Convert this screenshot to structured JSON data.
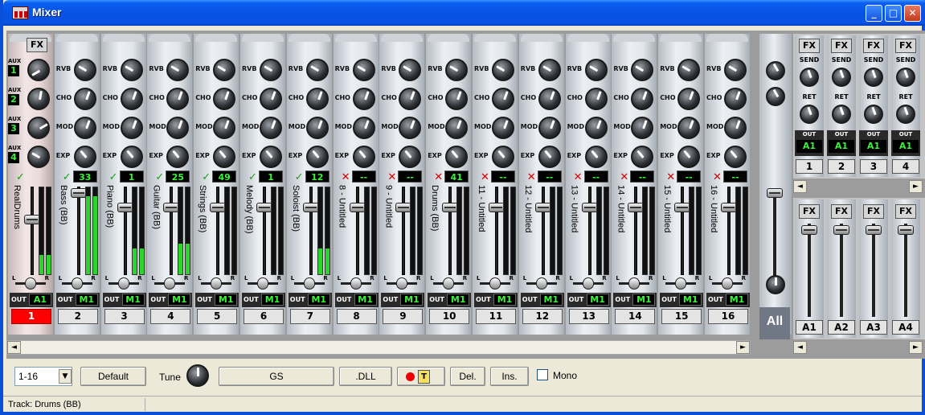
{
  "window": {
    "title": "Mixer",
    "minimize": "_",
    "maximize": "□",
    "close": "✕"
  },
  "aux": [
    "1",
    "2",
    "3",
    "4"
  ],
  "aux_label": "AUX",
  "row_labels": [
    "RVB",
    "CHO",
    "MOD",
    "EXP"
  ],
  "fx_label": "FX",
  "pan_left": "L",
  "pan_right": "R",
  "out_label": "OUT",
  "strips": [
    {
      "number": "1",
      "name": "RealDrums",
      "status": "ok",
      "status_glyph": "✓",
      "program": "",
      "out": "A1",
      "level": 0.22,
      "knobs": [
        240,
        10,
        60,
        300
      ],
      "selected": true
    },
    {
      "number": "2",
      "name": "Bass   (BB)",
      "status": "ok",
      "status_glyph": "✓",
      "program": "33",
      "out": "M1",
      "level": 0.9,
      "knobs": [
        300,
        20,
        20,
        320
      ],
      "selected": false
    },
    {
      "number": "3",
      "name": "Piano   (BB)",
      "status": "ok",
      "status_glyph": "✓",
      "program": "1",
      "out": "M1",
      "level": 0.3,
      "knobs": [
        300,
        20,
        20,
        320
      ],
      "selected": false
    },
    {
      "number": "4",
      "name": "Guitar   (BB)",
      "status": "ok",
      "status_glyph": "✓",
      "program": "25",
      "out": "M1",
      "level": 0.35,
      "knobs": [
        300,
        20,
        20,
        320
      ],
      "selected": false
    },
    {
      "number": "5",
      "name": "Strings (BB)",
      "status": "ok",
      "status_glyph": "✓",
      "program": "49",
      "out": "M1",
      "level": 0.0,
      "knobs": [
        300,
        20,
        20,
        320
      ],
      "selected": false
    },
    {
      "number": "6",
      "name": "Melody  (BB)",
      "status": "ok",
      "status_glyph": "✓",
      "program": "1",
      "out": "M1",
      "level": 0.0,
      "knobs": [
        300,
        20,
        20,
        320
      ],
      "selected": false
    },
    {
      "number": "7",
      "name": "Soloist (BB)",
      "status": "ok",
      "status_glyph": "✓",
      "program": "12",
      "out": "M1",
      "level": 0.3,
      "knobs": [
        300,
        20,
        20,
        320
      ],
      "selected": false
    },
    {
      "number": "8",
      "name": "8 - Untitled",
      "status": "x",
      "status_glyph": "✕",
      "program": "--",
      "out": "M1",
      "level": 0.0,
      "knobs": [
        300,
        20,
        20,
        320
      ],
      "selected": false
    },
    {
      "number": "9",
      "name": "9 - Untitled",
      "status": "x",
      "status_glyph": "✕",
      "program": "--",
      "out": "M1",
      "level": 0.0,
      "knobs": [
        300,
        20,
        20,
        320
      ],
      "selected": false
    },
    {
      "number": "10",
      "name": "Drums   (BB)",
      "status": "x",
      "status_glyph": "✕",
      "program": "41",
      "out": "M1",
      "level": 0.0,
      "knobs": [
        300,
        20,
        20,
        320
      ],
      "selected": false
    },
    {
      "number": "11",
      "name": "11 - Untitled",
      "status": "x",
      "status_glyph": "✕",
      "program": "--",
      "out": "M1",
      "level": 0.0,
      "knobs": [
        300,
        20,
        20,
        320
      ],
      "selected": false
    },
    {
      "number": "12",
      "name": "12 - Untitled",
      "status": "x",
      "status_glyph": "✕",
      "program": "--",
      "out": "M1",
      "level": 0.0,
      "knobs": [
        300,
        20,
        20,
        320
      ],
      "selected": false
    },
    {
      "number": "13",
      "name": "13 - Untitled",
      "status": "x",
      "status_glyph": "✕",
      "program": "--",
      "out": "M1",
      "level": 0.0,
      "knobs": [
        300,
        20,
        20,
        320
      ],
      "selected": false
    },
    {
      "number": "14",
      "name": "14 - Untitled",
      "status": "x",
      "status_glyph": "✕",
      "program": "--",
      "out": "M1",
      "level": 0.0,
      "knobs": [
        300,
        20,
        20,
        320
      ],
      "selected": false
    },
    {
      "number": "15",
      "name": "15 - Untitled",
      "status": "x",
      "status_glyph": "✕",
      "program": "--",
      "out": "M1",
      "level": 0.0,
      "knobs": [
        300,
        20,
        20,
        320
      ],
      "selected": false
    },
    {
      "number": "16",
      "name": "16 - Untitled",
      "status": "x",
      "status_glyph": "✕",
      "program": "--",
      "out": "M1",
      "level": 0.0,
      "knobs": [
        300,
        20,
        20,
        320
      ],
      "selected": false
    }
  ],
  "master": {
    "label": "All"
  },
  "fx_units": [
    {
      "send_label": "SEND",
      "ret_label": "RET",
      "out_label": "OUT",
      "out": "A1",
      "number": "1"
    },
    {
      "send_label": "SEND",
      "ret_label": "RET",
      "out_label": "OUT",
      "out": "A1",
      "number": "2"
    },
    {
      "send_label": "SEND",
      "ret_label": "RET",
      "out_label": "OUT",
      "out": "A1",
      "number": "3"
    },
    {
      "send_label": "SEND",
      "ret_label": "RET",
      "out_label": "OUT",
      "out": "A1",
      "number": "4"
    }
  ],
  "aux_strips": [
    {
      "label": "A1"
    },
    {
      "label": "A2"
    },
    {
      "label": "A3"
    },
    {
      "label": "A4"
    }
  ],
  "scroll": {
    "left": "◄",
    "right": "►"
  },
  "toolbar": {
    "range": "1-16",
    "range_arrow": "▼",
    "default": "Default",
    "tune": "Tune",
    "gs": "GS",
    "dll": ".DLL",
    "rec_icon": "T",
    "del": "Del.",
    "ins": "Ins.",
    "mono": "Mono"
  },
  "status": {
    "text": "Track: Drums   (BB)"
  },
  "colors": {
    "meter": "#2cd42c",
    "lcd_text": "#3cf03c",
    "selected_number": "#ff0000",
    "title_blue": "#0a5ef0"
  }
}
